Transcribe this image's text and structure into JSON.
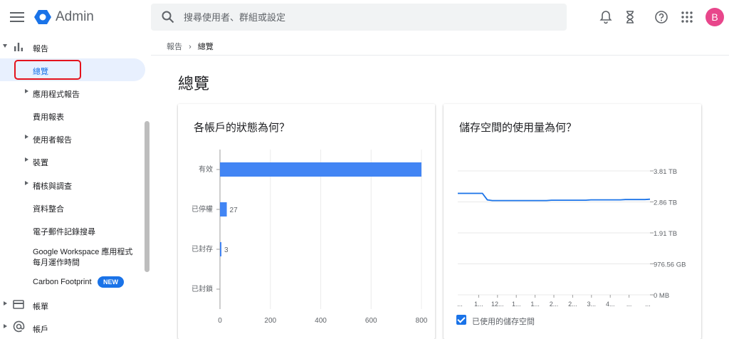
{
  "app": {
    "title": "Admin"
  },
  "search": {
    "placeholder": "搜尋使用者、群組或設定"
  },
  "topbar": {
    "avatar_letter": "B",
    "icons": [
      "bell-icon",
      "hourglass-icon",
      "help-icon",
      "apps-grid-icon"
    ]
  },
  "sidebar": {
    "reports": "報告",
    "overview": "總覽",
    "app_reports": "應用程式報告",
    "cost_reports": "費用報表",
    "user_reports": "使用者報告",
    "devices": "裝置",
    "audit": "稽核與調查",
    "data_integration": "資料整合",
    "email_log_search": "電子郵件記錄搜尋",
    "workspace_uptime_1": "Google Workspace 應用程式",
    "workspace_uptime_2": "每月運作時間",
    "carbon_footprint": "Carbon Footprint",
    "new_badge": "NEW",
    "billing": "帳單",
    "accounts": "帳戶"
  },
  "breadcrumb": {
    "parent": "報告",
    "separator": "›",
    "current": "總覽"
  },
  "page": {
    "title": "總覽"
  },
  "cards": {
    "accounts_title": "各帳戶的狀態為何？",
    "storage_title": "儲存空間的使用量為何？",
    "storage_legend": "已使用的儲存空間"
  },
  "colors": {
    "accent": "#1a73e8",
    "bar": "#4285f4",
    "avatar": "#e8468b",
    "highlight": "#e4121c"
  },
  "chart_data": [
    {
      "type": "bar",
      "orientation": "horizontal",
      "title": "各帳戶的狀態為何？",
      "categories": [
        "有效",
        "已停權",
        "已封存",
        "已封鎖"
      ],
      "values": [
        800,
        27,
        3,
        0
      ],
      "data_labels": [
        "",
        "27",
        "3",
        ""
      ],
      "xlim": [
        0,
        800
      ],
      "xticks": [
        "0",
        "200",
        "400",
        "600",
        "800"
      ],
      "grid": true
    },
    {
      "type": "line",
      "title": "儲存空間的使用量為何？",
      "yticks": [
        "0 MB",
        "976.56 GB",
        "1.91 TB",
        "2.86 TB",
        "3.81 TB"
      ],
      "ylim": [
        0,
        3.81
      ],
      "xticks": [
        "...",
        "1...",
        "12...",
        "1...",
        "1...",
        "2...",
        "2...",
        "3...",
        "4...",
        "...",
        "..."
      ],
      "series": [
        {
          "name": "已使用的儲存空間",
          "y": [
            3.12,
            3.12,
            3.12,
            3.12,
            3.12,
            3.12,
            2.92,
            2.9,
            2.9,
            2.9,
            2.9,
            2.9,
            2.9,
            2.9,
            2.9,
            2.9,
            2.9,
            2.9,
            2.9,
            2.91,
            2.91,
            2.91,
            2.91,
            2.91,
            2.91,
            2.91,
            2.91,
            2.92,
            2.92,
            2.92,
            2.92,
            2.92,
            2.92,
            2.92,
            2.93,
            2.93,
            2.93,
            2.93,
            2.93,
            2.94
          ]
        }
      ],
      "grid": true,
      "legend": "bottom-left"
    }
  ]
}
